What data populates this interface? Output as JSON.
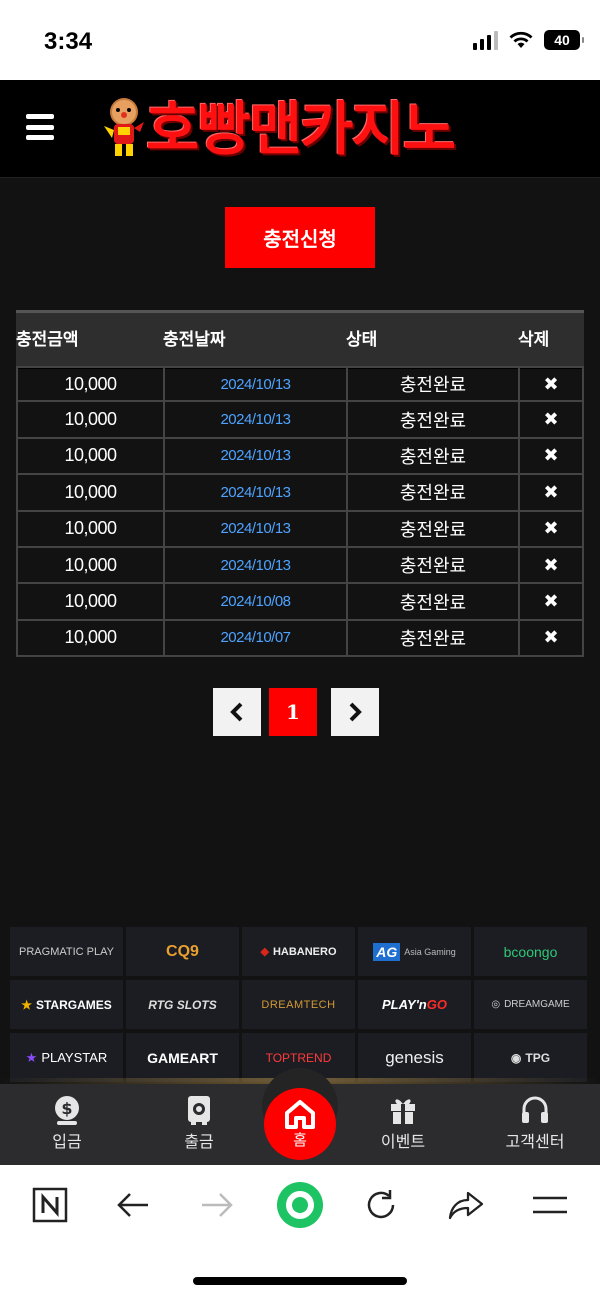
{
  "status_bar": {
    "time": "3:34",
    "battery": "40"
  },
  "header": {
    "logo_text": "호빵맨카지노"
  },
  "main": {
    "charge_request_label": "충전신청",
    "table": {
      "columns": [
        "충전금액",
        "충전날짜",
        "상태",
        "삭제"
      ],
      "rows": [
        {
          "amount": "10,000",
          "date": "2024/10/13",
          "status": "충전완료",
          "delete": "✖"
        },
        {
          "amount": "10,000",
          "date": "2024/10/13",
          "status": "충전완료",
          "delete": "✖"
        },
        {
          "amount": "10,000",
          "date": "2024/10/13",
          "status": "충전완료",
          "delete": "✖"
        },
        {
          "amount": "10,000",
          "date": "2024/10/13",
          "status": "충전완료",
          "delete": "✖"
        },
        {
          "amount": "10,000",
          "date": "2024/10/13",
          "status": "충전완료",
          "delete": "✖"
        },
        {
          "amount": "10,000",
          "date": "2024/10/13",
          "status": "충전완료",
          "delete": "✖"
        },
        {
          "amount": "10,000",
          "date": "2024/10/08",
          "status": "충전완료",
          "delete": "✖"
        },
        {
          "amount": "10,000",
          "date": "2024/10/07",
          "status": "충전완료",
          "delete": "✖"
        }
      ]
    },
    "pagination": {
      "prev": "‹",
      "current": "1",
      "next": "›"
    }
  },
  "providers": {
    "pragmatic": "PRAGMATIC PLAY",
    "cq9": "CQ9",
    "habanero": "HABANERO",
    "ag_mark": "AG",
    "ag_text": "Asia Gaming",
    "booongo": "bcoongo",
    "stargames": "STARGAMES",
    "rtg": "RTG SLOTS",
    "dreamtech": "DREAMTECH",
    "playngo_a": "PLAY'n ",
    "playngo_b": "GO",
    "dreamgame": "DREAMGAME",
    "playstar": "PLAYSTAR",
    "gameart": "GAMEART",
    "toptrend": "TOPTREND",
    "genesis": "genesis",
    "tpg": "TPG"
  },
  "bottom_nav": {
    "deposit": "입금",
    "withdraw": "출금",
    "home": "홈",
    "event": "이벤트",
    "support": "고객센터"
  },
  "colors": {
    "accent": "#ff0000",
    "date_link": "#4da3ff",
    "background": "#121212"
  }
}
